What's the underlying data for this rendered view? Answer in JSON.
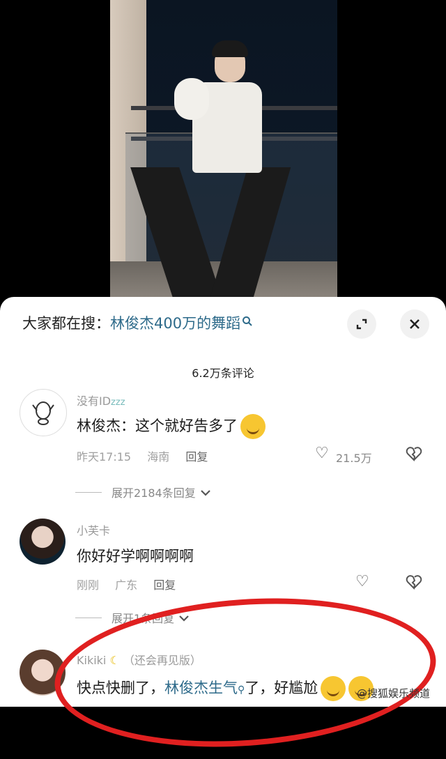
{
  "search": {
    "prefix": "大家都在搜：",
    "keyword": "林俊杰400万的舞蹈",
    "search_icon": "search-icon"
  },
  "buttons": {
    "expand_icon": "expand-icon",
    "close_icon": "close-icon"
  },
  "comment_count": "6.2万条评论",
  "comments": [
    {
      "name": "没有ID",
      "name_suffix": "zzz",
      "text": "林俊杰：这个就好告多了",
      "emoji": "smile-emoji",
      "time": "昨天17:15",
      "location": "海南",
      "reply": "回复",
      "likes": "21.5万",
      "expand": "展开2184条回复"
    },
    {
      "name": "小芙卡",
      "text": "你好好学啊啊啊啊",
      "time": "刚刚",
      "location": "广东",
      "reply": "回复",
      "expand": "展开1条回复"
    },
    {
      "name": "Kikiki",
      "name_suffix": "（还会再见版）",
      "text_a": "快点快删了，",
      "text_kw": "林俊杰生气",
      "text_b": "了，好",
      "text_c": "尴尬"
    }
  ],
  "watermark": "@搜狐娱乐频道",
  "colors": {
    "keyword": "#2d6a8a",
    "annotation": "#e02020",
    "sheet": "#ffffff"
  }
}
